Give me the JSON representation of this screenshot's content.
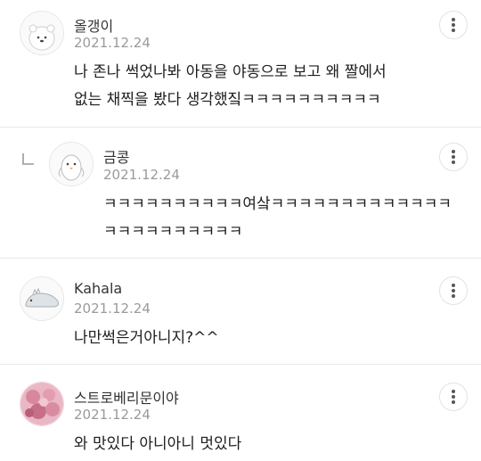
{
  "comments": [
    {
      "author": "올갱이",
      "date": "2021.12.24",
      "text": "나 존나 썩었나봐 아동을 야동으로 보고 왜 짤에서\n없는 채찍을 봤다 생각했짘ㅋㅋㅋㅋㅋㅋㅋㅋㅋㅋ",
      "avatar_icon": "white-bear-avatar-icon"
    },
    {
      "author": "금콩",
      "date": "2021.12.24",
      "text": "ㅋㅋㅋㅋㅋㅋㅋㅋㅋㅋ여샄ㅋㅋㅋㅋㅋㅋㅋㅋㅋㅋㅋㅋㅋ\nㅋㅋㅋㅋㅋㅋㅋㅋㅋㅋ",
      "avatar_icon": "penguin-avatar-icon",
      "is_reply": true
    },
    {
      "author": "Kahala",
      "date": "2021.12.24",
      "text": "나만썩은거아니지?^^",
      "avatar_icon": "dinosaur-avatar-icon"
    },
    {
      "author": "스트로베리문이야",
      "date": "2021.12.24",
      "text": "와 맛있다 아니아니 멋있다",
      "avatar_icon": "flower-photo-avatar-icon"
    }
  ],
  "colors": {
    "divider": "#e9e9e9",
    "date": "#9a9a9a",
    "text": "#1e1e1e"
  }
}
